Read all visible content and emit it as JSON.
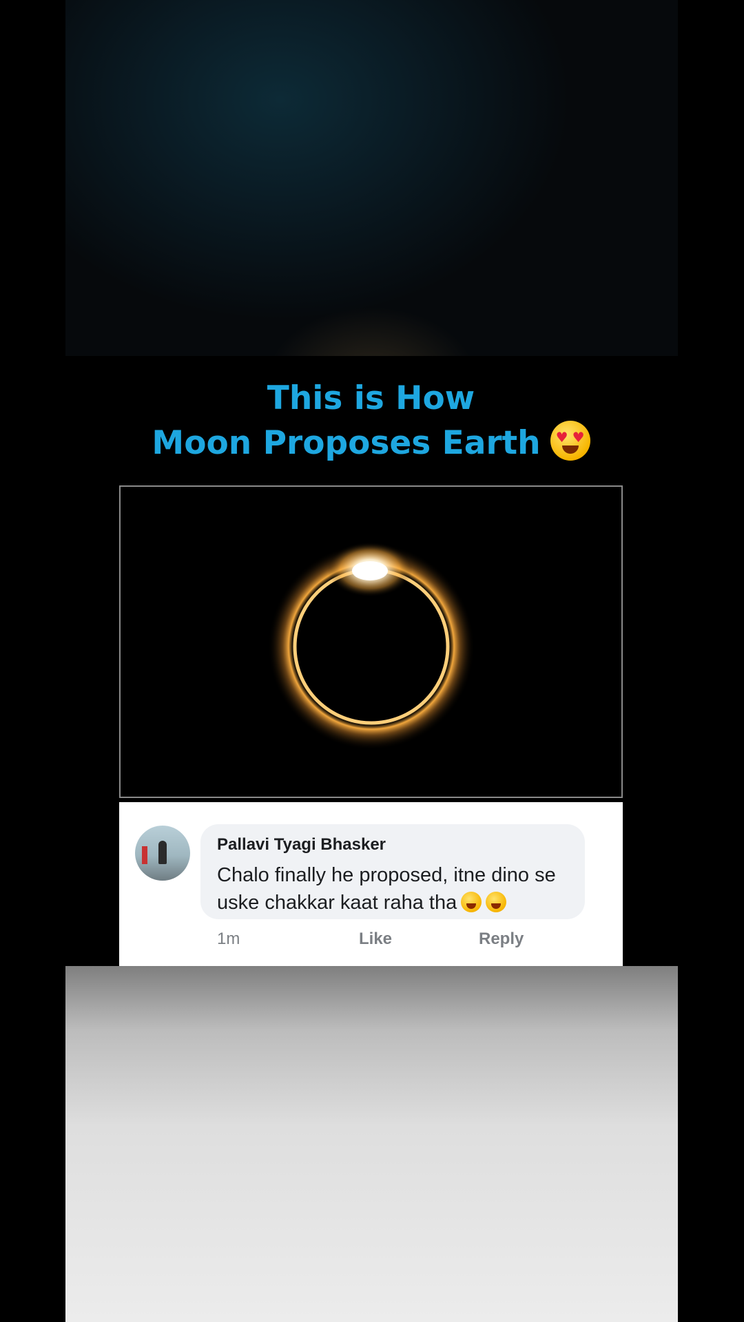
{
  "post": {
    "headline_line1": "This is How",
    "headline_line2": "Moon Proposes Earth",
    "headline_emoji": "heart-eyes-emoji",
    "headline_color": "#1ea7e0"
  },
  "photo": {
    "subject": "diamond-ring-eclipse-image"
  },
  "comment": {
    "author": "Pallavi Tyagi Bhasker",
    "text": "Chalo finally he proposed, itne dino se uske chakkar kaat raha tha",
    "emojis": [
      "squinting-tongue-emoji",
      "laughing-emoji"
    ],
    "time": "1m",
    "like_label": "Like",
    "reply_label": "Reply"
  }
}
